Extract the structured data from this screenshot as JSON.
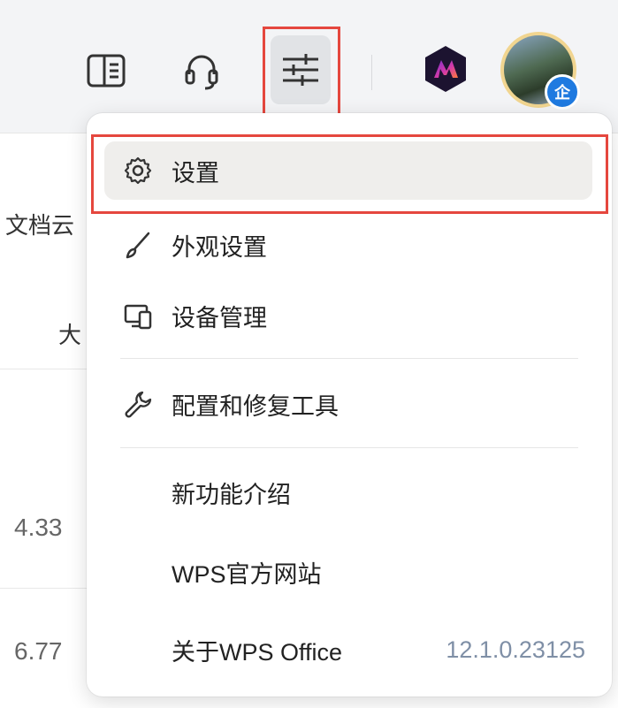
{
  "toolbar": {
    "icons": [
      "sidebar-toggle-icon",
      "headset-icon",
      "settings-sliders-icon",
      "ai-assistant-logo",
      "user-avatar"
    ],
    "avatar_badge": "企"
  },
  "background": {
    "cloud_label": "文档云",
    "size_header": "大",
    "row1_size": "4.33",
    "row2_size": "6.77"
  },
  "menu": {
    "items": [
      {
        "label": "设置",
        "icon": "gear-icon"
      },
      {
        "label": "外观设置",
        "icon": "brush-icon"
      },
      {
        "label": "设备管理",
        "icon": "devices-icon"
      },
      {
        "label": "配置和修复工具",
        "icon": "wrench-icon"
      },
      {
        "label": "新功能介绍",
        "icon": ""
      },
      {
        "label": "WPS官方网站",
        "icon": ""
      },
      {
        "label": "关于WPS Office",
        "icon": "",
        "version": "12.1.0.23125"
      }
    ]
  },
  "colors": {
    "highlight": "#e5473e",
    "active_item_bg": "#efeeec",
    "version_text": "#7f8fa6",
    "badge": "#1f7ae0"
  }
}
